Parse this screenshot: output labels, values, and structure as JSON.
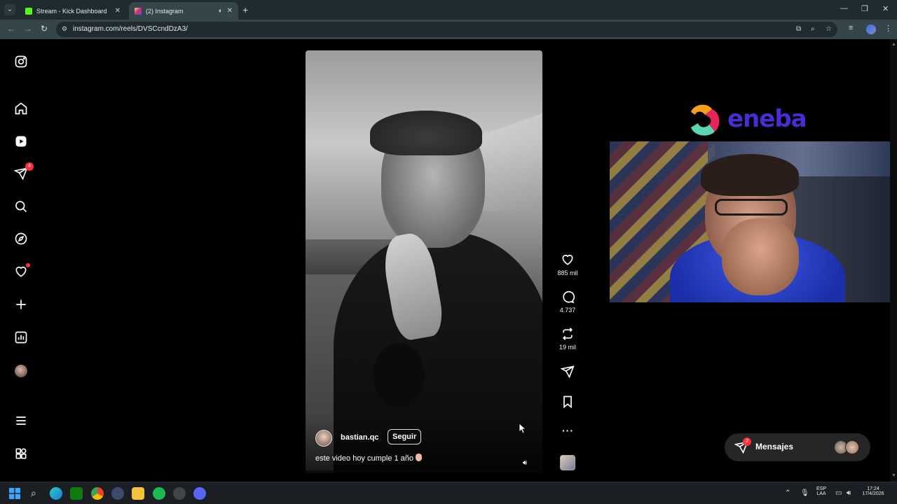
{
  "browser": {
    "tabs": [
      {
        "title": "Stream - Kick Dashboard",
        "favicon_color": "#53fc18",
        "active": false
      },
      {
        "title": "(2) Instagram",
        "favicon_color": "#e1306c",
        "active": true
      }
    ],
    "url": "instagram.com/reels/DVSCcndDzA3/"
  },
  "sidebar": {
    "items": [
      {
        "name": "instagram-logo-icon",
        "kind": "logo"
      },
      {
        "name": "home-icon",
        "kind": "nav"
      },
      {
        "name": "reels-icon",
        "kind": "nav"
      },
      {
        "name": "messages-icon",
        "kind": "nav",
        "badge": "4"
      },
      {
        "name": "search-icon",
        "kind": "nav"
      },
      {
        "name": "explore-icon",
        "kind": "nav"
      },
      {
        "name": "notifications-icon",
        "kind": "nav",
        "dot": true
      },
      {
        "name": "create-icon",
        "kind": "nav"
      },
      {
        "name": "dashboard-icon",
        "kind": "nav"
      },
      {
        "name": "profile-avatar",
        "kind": "nav"
      },
      {
        "name": "more-menu-icon",
        "kind": "nav"
      },
      {
        "name": "also-from-meta-icon",
        "kind": "nav"
      }
    ]
  },
  "reel": {
    "username": "bastian.qc",
    "follow_label": "Seguir",
    "caption": "este video hoy cumple 1 año"
  },
  "actions": {
    "likes": "885 mil",
    "comments": "4.737",
    "reposts": "19 mil"
  },
  "overlay": {
    "sponsor_logo_text": "eneba",
    "sponsor_color": "#4b2bd6"
  },
  "messages_pill": {
    "label": "Mensajes",
    "badge": "2"
  },
  "taskbar": {
    "language_top": "ESP",
    "language_bottom": "LAA",
    "time": "17:24",
    "date": "17/4/2026"
  }
}
